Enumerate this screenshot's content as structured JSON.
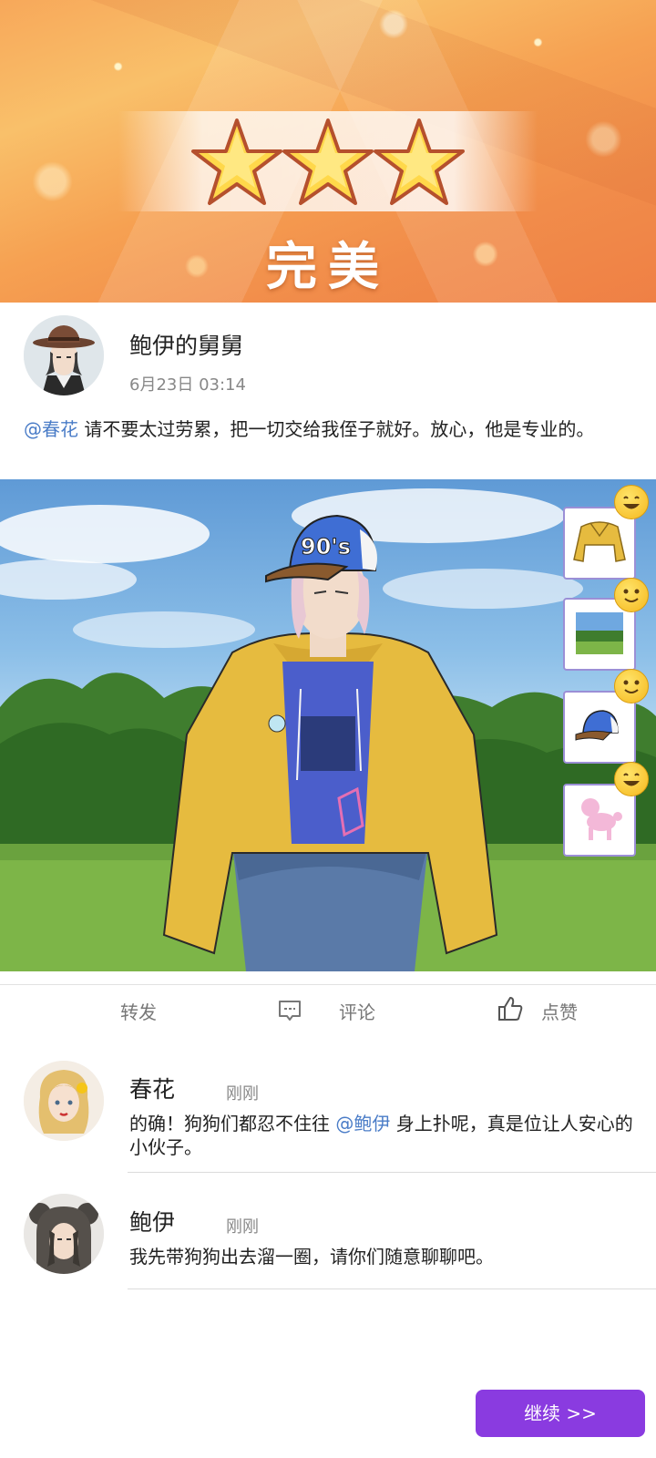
{
  "result": {
    "label": "完美",
    "stars_earned": 3,
    "stars_total": 3
  },
  "post": {
    "author": "鲍伊的舅舅",
    "time": "6月23日 03:14",
    "mention": "@春花",
    "text": " 请不要太过劳累，把一切交给我侄子就好。放心，他是专业的。"
  },
  "outfit": {
    "cap_text": "90's",
    "items": [
      {
        "icon": "yellow-hoodie-icon",
        "reaction": "laughing-face"
      },
      {
        "icon": "park-background-icon",
        "reaction": "smiling-face"
      },
      {
        "icon": "90s-cap-icon",
        "reaction": "smiling-face"
      },
      {
        "icon": "pink-poodle-icon",
        "reaction": "laughing-face"
      }
    ]
  },
  "actions": {
    "share": "转发",
    "comment": "评论",
    "like": "点赞"
  },
  "comments": [
    {
      "name": "春花",
      "time": "刚刚",
      "text_before": "的确！狗狗们都忍不住往 ",
      "mention": "@鲍伊",
      "text_after": " 身上扑呢，真是位让人安心的小伙子。"
    },
    {
      "name": "鲍伊",
      "time": "刚刚",
      "text_before": "我先带狗狗出去溜一圈，请你们随意聊聊吧。",
      "mention": "",
      "text_after": ""
    }
  ],
  "continue_label": "继续 >>",
  "colors": {
    "accent": "#8a3be0",
    "mention": "#4a7cc7",
    "banner": "#f6a152"
  }
}
